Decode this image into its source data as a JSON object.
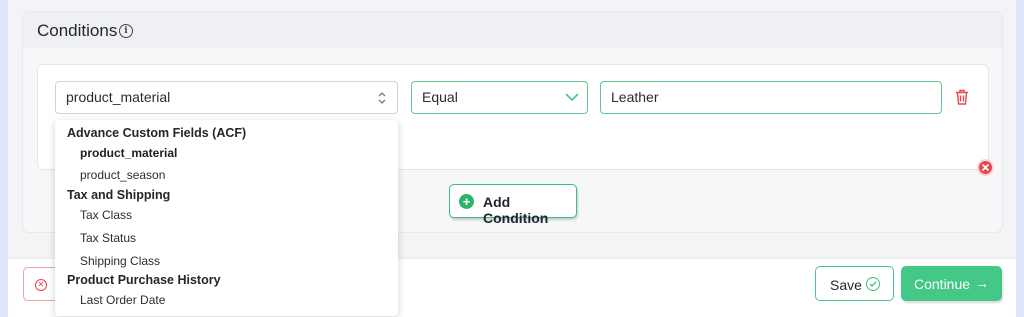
{
  "conditions": {
    "title": "Conditions",
    "info_icon": "info-icon",
    "attribute_value": "product_material",
    "operator_value": "Equal",
    "value_value": "Leather",
    "add_condition_label": "Add Condition"
  },
  "dropdown": {
    "groups": [
      {
        "label": "Advance Custom Fields (ACF)",
        "options": [
          "product_material",
          "product_season"
        ]
      },
      {
        "label": "Tax and Shipping",
        "options": [
          "Tax Class",
          "Tax Status",
          "Shipping Class"
        ]
      },
      {
        "label": "Product Purchase History",
        "options": [
          "Last Order Date"
        ]
      }
    ],
    "selected": "product_material"
  },
  "footer": {
    "save_label": "Save",
    "continue_label": "Continue",
    "continue_arrow": "→"
  },
  "colors": {
    "accent_green": "#43c887",
    "danger_red": "#e5484d",
    "background": "#dfe6fb"
  }
}
